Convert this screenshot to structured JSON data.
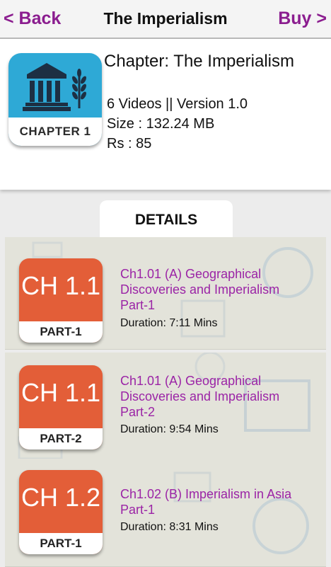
{
  "header": {
    "back_label": "< Back",
    "title": "The Imperialism",
    "buy_label": "Buy >"
  },
  "chapter": {
    "icon_label": "CHAPTER 1",
    "name": "Chapter: The Imperialism",
    "videos_version": "6 Videos || Version 1.0",
    "size": "Size : 132.24 MB",
    "price": "Rs : 85"
  },
  "details_tab_label": "DETAILS",
  "videos": [
    {
      "badge": "CH 1.1",
      "part": "PART-1",
      "title": "Ch1.01 (A) Geographical Discoveries and Imperialism Part-1",
      "duration": "Duration: 7:11 Mins"
    },
    {
      "badge": "CH 1.1",
      "part": "PART-2",
      "title": "Ch1.01 (A) Geographical Discoveries and Imperialism Part-2",
      "duration": "Duration: 9:54 Mins"
    },
    {
      "badge": "CH 1.2",
      "part": "PART-1",
      "title": "Ch1.02 (B) Imperialism in Asia Part-1",
      "duration": "Duration: 8:31 Mins"
    }
  ],
  "colors": {
    "accent_purple": "#8b1d8f",
    "video_title": "#9b24a6",
    "badge_orange": "#e35e38",
    "chapter_icon_blue": "#2ea9d6"
  }
}
